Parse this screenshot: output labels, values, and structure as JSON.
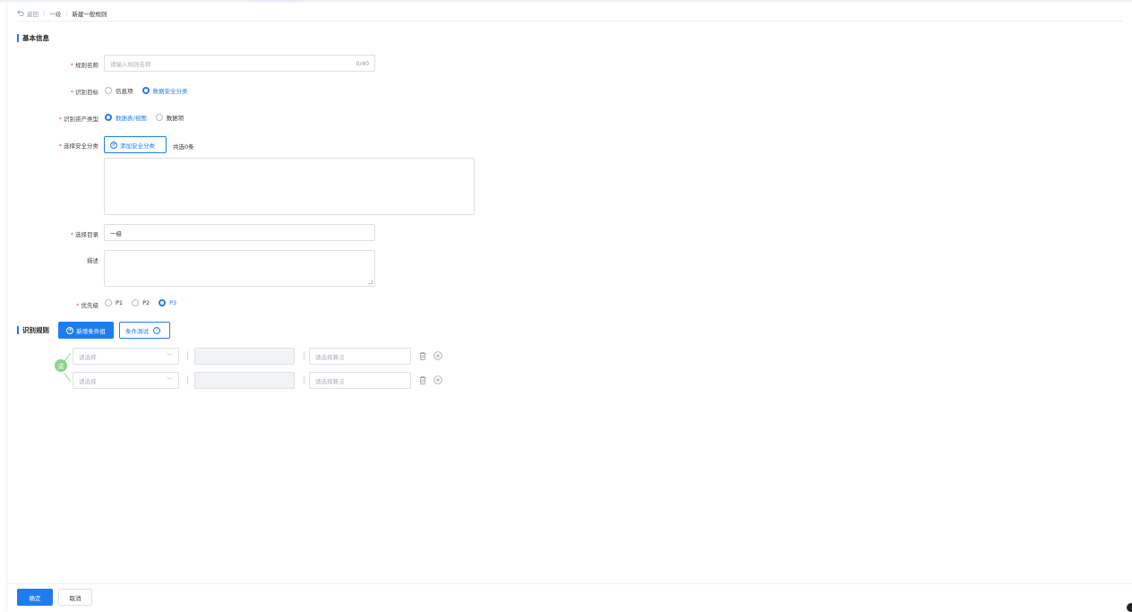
{
  "breadcrumb": {
    "back": "返回",
    "separator": "|",
    "parent": "一级",
    "slash": "/",
    "current": "新建一般规则"
  },
  "basic_info": {
    "title": "基本信息"
  },
  "form": {
    "rule_name": {
      "label": "规则名称",
      "placeholder": "请输入规则名称",
      "count": "0/40"
    },
    "target": {
      "label": "识别目标",
      "options": [
        "信息项",
        "数据安全分类"
      ],
      "selected": "数据安全分类"
    },
    "asset_type": {
      "label": "识别资产类型",
      "options": [
        "数据表/视图",
        "数据项"
      ],
      "selected": "数据表/视图"
    },
    "security_class": {
      "label": "选择安全分类",
      "add_button": "添加安全分类",
      "total": "共选0条"
    },
    "directory": {
      "label": "选择目录",
      "value": "一级"
    },
    "description": {
      "label": "描述"
    },
    "priority": {
      "label": "优先级",
      "options": [
        "P1",
        "P2",
        "P3"
      ],
      "selected": "P3"
    }
  },
  "rules": {
    "title": "识别规则",
    "add_group_button": "新增条件组",
    "test_button": "条件测试",
    "or_badge": "或",
    "rows": [
      {
        "select_placeholder": "请选择",
        "algorithm_placeholder": "请选择算法"
      },
      {
        "select_placeholder": "请选择",
        "algorithm_placeholder": "请选择算法"
      }
    ]
  },
  "footer": {
    "confirm": "确定",
    "cancel": "取消"
  },
  "colors": {
    "accent": "#1f7cf0",
    "required": "#f04d4d",
    "or_badge": "#8bd48b"
  }
}
